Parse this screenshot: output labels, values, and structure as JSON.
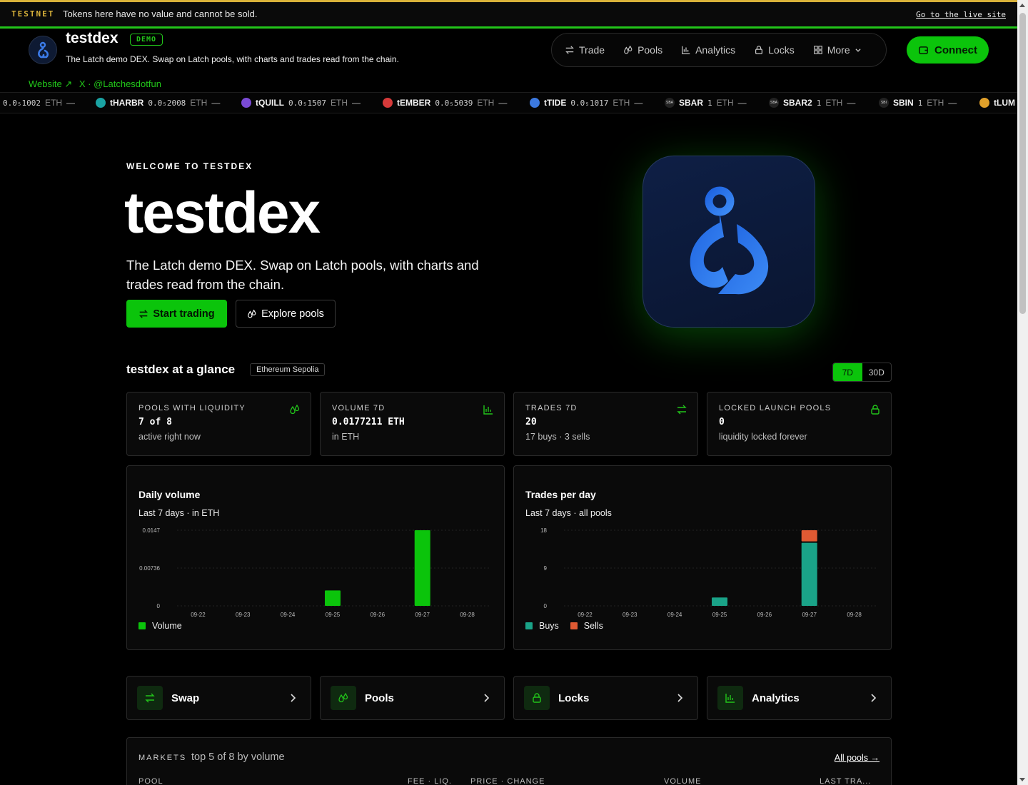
{
  "banner": {
    "tag": "TESTNET",
    "message": "Tokens here have no value and cannot be sold.",
    "live_link": "Go to the live site"
  },
  "header": {
    "brand": "testdex",
    "badge": "DEMO",
    "tagline": "The Latch demo DEX. Swap on Latch pools, with charts and trades read from the chain.",
    "website_link": "Website ↗",
    "x_link": "X · @Latchesdotfun",
    "nav": [
      {
        "label": "Trade",
        "icon": "swap-icon"
      },
      {
        "label": "Pools",
        "icon": "drops-icon"
      },
      {
        "label": "Analytics",
        "icon": "bar-chart-icon"
      },
      {
        "label": "Locks",
        "icon": "lock-icon"
      },
      {
        "label": "More",
        "icon": "grid-icon"
      }
    ],
    "connect_label": "Connect"
  },
  "ticker": [
    {
      "symbol": "",
      "price": "0.0₅1002",
      "unit": "ETH",
      "color": "#444444"
    },
    {
      "symbol": "tHARBR",
      "price": "0.0₅2008",
      "unit": "ETH",
      "color": "#1aa3a3"
    },
    {
      "symbol": "tQUILL",
      "price": "0.0₅1507",
      "unit": "ETH",
      "color": "#7b4bd6"
    },
    {
      "symbol": "tEMBER",
      "price": "0.0₅5039",
      "unit": "ETH",
      "color": "#d63a3a"
    },
    {
      "symbol": "tTIDE",
      "price": "0.0₅1017",
      "unit": "ETH",
      "color": "#3c79e0"
    },
    {
      "symbol": "SBAR",
      "price": "1",
      "unit": "ETH",
      "color": "#222222"
    },
    {
      "symbol": "SBAR2",
      "price": "1",
      "unit": "ETH",
      "color": "#222222"
    },
    {
      "symbol": "SBIN",
      "price": "1",
      "unit": "ETH",
      "color": "#222222"
    },
    {
      "symbol": "tLUM",
      "price": "",
      "unit": "",
      "color": "#e0a02a"
    }
  ],
  "ticker_dot_labels": [
    "",
    "",
    "",
    "",
    "",
    "SBA",
    "SBA",
    "SBI",
    ""
  ],
  "hero": {
    "welcome": "WELCOME TO TESTDEX",
    "title": "testdex",
    "description": "The Latch demo DEX. Swap on Latch pools, with charts and trades read from the chain.",
    "primary_cta": "Start trading",
    "secondary_cta": "Explore pools"
  },
  "glance": {
    "title": "testdex at a glance",
    "chain": "Ethereum Sepolia",
    "ranges": [
      "7D",
      "30D"
    ],
    "selected_range": "7D",
    "stats": [
      {
        "label": "POOLS WITH LIQUIDITY",
        "value": "7 of 8",
        "sub": "active right now",
        "icon": "drops-icon"
      },
      {
        "label": "VOLUME 7D",
        "value": "0.0177211 ETH",
        "sub": "in ETH",
        "icon": "bar-chart-icon"
      },
      {
        "label": "TRADES 7D",
        "value": "20",
        "sub": "17 buys · 3 sells",
        "icon": "swap-icon"
      },
      {
        "label": "LOCKED LAUNCH POOLS",
        "value": "0",
        "sub": "liquidity locked forever",
        "icon": "lock-icon"
      }
    ]
  },
  "chart_data": [
    {
      "type": "bar",
      "title": "Daily volume",
      "subtitle": "Last 7 days · in ETH",
      "categories": [
        "09-22",
        "09-23",
        "09-24",
        "09-25",
        "09-26",
        "09-27",
        "09-28"
      ],
      "series": [
        {
          "name": "Volume",
          "values": [
            0,
            0,
            0,
            0.003,
            0,
            0.0147,
            0
          ],
          "color": "#0bc40b"
        }
      ],
      "yticks": [
        "0",
        "0.00736",
        "0.0147"
      ],
      "ylim": [
        0,
        0.0147
      ],
      "legend": "bottom-left",
      "grid": true
    },
    {
      "type": "bar",
      "stacked": true,
      "title": "Trades per day",
      "subtitle": "Last 7 days · all pools",
      "categories": [
        "09-22",
        "09-23",
        "09-24",
        "09-25",
        "09-26",
        "09-27",
        "09-28"
      ],
      "series": [
        {
          "name": "Buys",
          "values": [
            0,
            0,
            0,
            2,
            0,
            15,
            0
          ],
          "color": "#1aa388"
        },
        {
          "name": "Sells",
          "values": [
            0,
            0,
            0,
            0,
            0,
            3,
            0
          ],
          "color": "#e05a33"
        }
      ],
      "yticks": [
        "0",
        "9",
        "18"
      ],
      "ylim": [
        0,
        18
      ],
      "legend": "bottom-left",
      "grid": true
    }
  ],
  "quick_links": [
    {
      "label": "Swap",
      "icon": "swap-icon"
    },
    {
      "label": "Pools",
      "icon": "drops-icon"
    },
    {
      "label": "Locks",
      "icon": "lock-icon"
    },
    {
      "label": "Analytics",
      "icon": "bar-chart-icon"
    }
  ],
  "markets": {
    "title": "MARKETS",
    "subtitle": "top 5 of 8 by volume",
    "all_link": "All pools →",
    "columns": [
      "POOL",
      "FEE · LIQ.",
      "PRICE · CHANGE",
      "VOLUME",
      "LAST TRA..."
    ]
  },
  "colors": {
    "accent": "#0bc40b",
    "warning": "#d9b23a",
    "buys": "#1aa388",
    "sells": "#e05a33"
  }
}
